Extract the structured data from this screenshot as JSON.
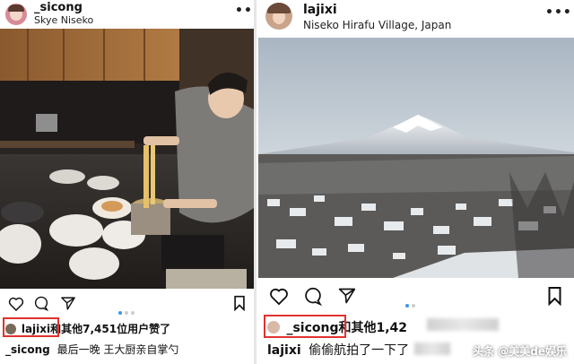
{
  "left_post": {
    "username": "_sicong",
    "location": "Skye Niseko",
    "more_icon": "more-horizontal-icon",
    "liked_by_user": "lajixi",
    "likes_text": "和其他7,451位用户赞了",
    "caption_user": "_sicong",
    "caption_text": "最后一晚 王大厨亲自掌勺"
  },
  "right_post": {
    "username": "lajixi",
    "location": "Niseko Hirafu Village, Japan",
    "more_icon": "more-horizontal-icon",
    "liked_by_user": "_sicong",
    "likes_text": "和其他1,42",
    "caption_user": "lajixi",
    "caption_text": "偷偷航拍了一下了"
  },
  "watermark": "头条 @美美de娱乐",
  "colors": {
    "highlight_box": "#e0322e",
    "carousel_active": "#3897f0"
  }
}
